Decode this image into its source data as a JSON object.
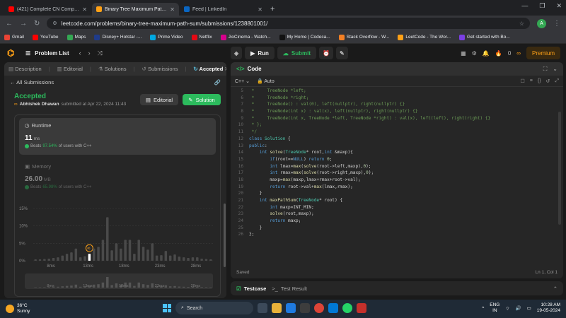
{
  "browser": {
    "tabs": [
      {
        "title": "(421) Complete CN Computer N",
        "color": "#ff0000",
        "active": false
      },
      {
        "title": "Binary Tree Maximum Path Sum",
        "color": "#ffa116",
        "active": true
      },
      {
        "title": "Feed | LinkedIn",
        "color": "#0a66c2",
        "active": false
      }
    ],
    "new_tab": "+",
    "url": "leetcode.com/problems/binary-tree-maximum-path-sum/submissions/1238801001/",
    "profile_initial": "A",
    "bookmarks": [
      {
        "label": "Gmail",
        "color": "#ea4335"
      },
      {
        "label": "YouTube",
        "color": "#ff0000"
      },
      {
        "label": "Maps",
        "color": "#34a853"
      },
      {
        "label": "Disney+ Hotstar -...",
        "color": "#1f3b8a"
      },
      {
        "label": "Prime Video",
        "color": "#00a8e1"
      },
      {
        "label": "Netflix",
        "color": "#e50914"
      },
      {
        "label": "JioCinema - Watch...",
        "color": "#d9008d"
      },
      {
        "label": "My Home | Codeca...",
        "color": "#111111"
      },
      {
        "label": "Stack Overflow - W...",
        "color": "#f48024"
      },
      {
        "label": "LeetCode - The Wor...",
        "color": "#ffa116"
      },
      {
        "label": "Get started with Bo...",
        "color": "#7b3fe4"
      }
    ]
  },
  "lc": {
    "problem_list": "Problem List",
    "run": "Run",
    "submit": "Submit",
    "streak": "0",
    "premium": "Premium"
  },
  "left": {
    "tabs": [
      "Description",
      "Editorial",
      "Solutions",
      "Submissions",
      "Accepted"
    ],
    "all_submissions": "All Submissions",
    "status": "Accepted",
    "user": "Abhishek Dhawan",
    "submitted_at": "submitted at Apr 22, 2024 11:43",
    "editorial_btn": "Editorial",
    "solution_btn": "Solution",
    "runtime_label": "Runtime",
    "runtime_value": "11",
    "runtime_unit": "ms",
    "runtime_beats_prefix": "Beats",
    "runtime_beats_pct": "97.54%",
    "runtime_beats_suffix": "of users with C++",
    "memory_label": "Memory",
    "memory_value": "26.00",
    "memory_unit": "MB",
    "memory_beats_prefix": "Beats",
    "memory_beats_pct": "65.98%",
    "memory_beats_suffix": "of users with C++"
  },
  "chart_data": {
    "type": "bar",
    "ytick_labels": [
      "15%",
      "10%",
      "5%",
      "0%"
    ],
    "yticks": [
      15,
      10,
      5,
      0
    ],
    "ylim": [
      0,
      15
    ],
    "xtick_labels": [
      "8ms",
      "13ms",
      "18ms",
      "23ms",
      "28ms"
    ],
    "values": [
      0.4,
      0.4,
      0.5,
      0.6,
      0.8,
      1.0,
      1.5,
      2.0,
      2.4,
      3.5,
      1.0,
      1.3,
      2.0,
      3.5,
      4.0,
      6.0,
      12.5,
      3.0,
      5.0,
      3.5,
      6.0,
      6.0,
      2.0,
      6.0,
      4.0,
      3.2,
      5.0,
      1.5,
      1.6,
      2.8,
      1.5,
      1.8,
      1.2,
      1.0,
      0.8,
      1.0,
      1.0,
      0.6,
      0.5,
      0.4
    ],
    "highlight_index": 12
  },
  "code": {
    "title": "Code",
    "language": "C++",
    "autosave": "Auto",
    "saved": "Saved",
    "cursor": "Ln 1, Col 1",
    "lines": [
      {
        "n": "5",
        "html": "<span class='c-com'> *     TreeNode *left;</span>"
      },
      {
        "n": "6",
        "html": "<span class='c-com'> *     TreeNode *right;</span>"
      },
      {
        "n": "7",
        "html": "<span class='c-com'> *     TreeNode() : val(0), left(nullptr), right(nullptr) {}</span>"
      },
      {
        "n": "8",
        "html": "<span class='c-com'> *     TreeNode(int x) : val(x), left(nullptr), right(nullptr) {}</span>"
      },
      {
        "n": "9",
        "html": "<span class='c-com'> *     TreeNode(int x, TreeNode *left, TreeNode *right) : val(x), left(left), right(right) {}</span>"
      },
      {
        "n": "10",
        "html": "<span class='c-com'> * };</span>"
      },
      {
        "n": "11",
        "html": "<span class='c-com'> */</span>"
      },
      {
        "n": "12",
        "html": "<span class='c-kw'>class</span> <span class='c-ty'>Solution</span> {"
      },
      {
        "n": "13",
        "html": "<span class='c-kw'>public</span>:"
      },
      {
        "n": "14",
        "html": "    <span class='c-kw'>int</span> <span class='c-fn'>solve</span>(<span class='c-ty'>TreeNode</span>* root,<span class='c-kw'>int</span> &amp;maxp){"
      },
      {
        "n": "15",
        "html": "        <span class='c-kw'>if</span>(root==<span class='c-kw'>NULL</span>) <span class='c-kw'>return</span> <span class='c-num'>0</span>;"
      },
      {
        "n": "16",
        "html": "        <span class='c-kw'>int</span> lmax=<span class='c-fn'>max</span>(<span class='c-fn'>solve</span>(root-&gt;left,maxp),<span class='c-num'>0</span>);"
      },
      {
        "n": "17",
        "html": "        <span class='c-kw'>int</span> rmax=<span class='c-fn'>max</span>(<span class='c-fn'>solve</span>(root-&gt;right,maxp),<span class='c-num'>0</span>);"
      },
      {
        "n": "18",
        "html": "        maxp=<span class='c-fn'>max</span>(maxp,lmax+rmax+root-&gt;val);"
      },
      {
        "n": "19",
        "html": "        <span class='c-kw'>return</span> root-&gt;val+<span class='c-fn'>max</span>(lmax,rmax);"
      },
      {
        "n": "20",
        "html": "    }"
      },
      {
        "n": "21",
        "html": "    <span class='c-kw'>int</span> <span class='c-fn'>maxPathSum</span>(<span class='c-ty'>TreeNode</span>* root) {"
      },
      {
        "n": "22",
        "html": "        <span class='c-kw'>int</span> maxp=INT_MIN;"
      },
      {
        "n": "23",
        "html": "        <span class='c-fn'>solve</span>(root,maxp);"
      },
      {
        "n": "24",
        "html": "        <span class='c-kw'>return</span> maxp;"
      },
      {
        "n": "25",
        "html": "    }"
      },
      {
        "n": "26",
        "html": "};"
      }
    ]
  },
  "testpanel": {
    "testcase": "Testcase",
    "result": "Test Result"
  },
  "taskbar": {
    "temp": "36°C",
    "weather": "Sunny",
    "search": "Search",
    "lang1": "ENG",
    "lang2": "IN",
    "time": "10:28 AM",
    "date": "19-05-2024"
  }
}
